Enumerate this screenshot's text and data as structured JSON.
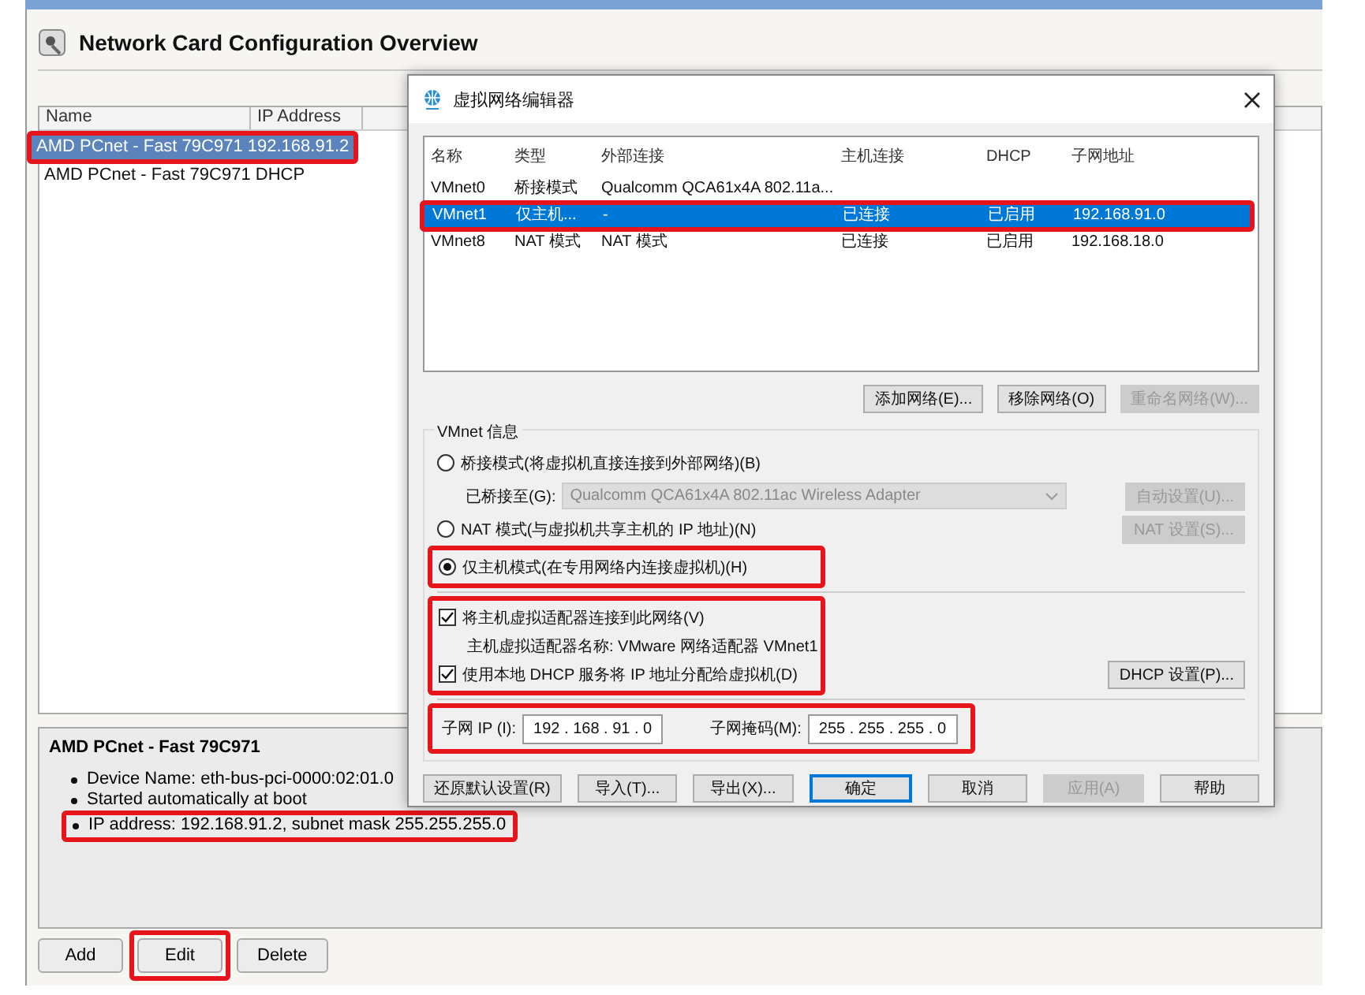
{
  "main_window": {
    "title": "Network Card Configuration Overview",
    "list": {
      "columns": [
        "Name",
        "IP Address"
      ],
      "rows": [
        {
          "name": "AMD PCnet - Fast 79C971",
          "ip": "192.168.91.2",
          "selected": true
        },
        {
          "name": "AMD PCnet - Fast 79C971",
          "ip": "DHCP",
          "selected": false
        }
      ]
    },
    "details": {
      "title": "AMD PCnet - Fast 79C971",
      "items": [
        "Device Name: eth-bus-pci-0000:02:01.0",
        "Started automatically at boot",
        "IP address: 192.168.91.2, subnet mask 255.255.255.0"
      ]
    },
    "buttons": [
      {
        "label": "Add"
      },
      {
        "label": "Edit"
      },
      {
        "label": "Delete"
      }
    ]
  },
  "dialog": {
    "title": "虚拟网络编辑器",
    "table": {
      "columns": [
        "名称",
        "类型",
        "外部连接",
        "主机连接",
        "DHCP",
        "子网地址"
      ],
      "rows": [
        {
          "cells": [
            "VMnet0",
            "桥接模式",
            "Qualcomm QCA61x4A 802.11a..."
          ],
          "selected": false
        },
        {
          "cells": [
            "VMnet1",
            "仅主机...",
            "-",
            "已连接",
            "已启用",
            "192.168.91.0"
          ],
          "selected": true
        },
        {
          "cells": [
            "VMnet8",
            "NAT 模式",
            "NAT 模式",
            "已连接",
            "已启用",
            "192.168.18.0"
          ],
          "selected": false
        }
      ]
    },
    "table_buttons": [
      {
        "label": "添加网络(E)...",
        "disabled": false
      },
      {
        "label": "移除网络(O)",
        "disabled": false
      },
      {
        "label": "重命名网络(W)...",
        "disabled": true
      }
    ],
    "group_title": "VMnet 信息",
    "modes": [
      {
        "label": "桥接模式(将虚拟机直接连接到外部网络)(B)",
        "selected": false
      },
      {
        "label": "NAT 模式(与虚拟机共享主机的 IP 地址)(N)",
        "selected": false
      },
      {
        "label": "仅主机模式(在专用网络内连接虚拟机)(H)",
        "selected": true
      }
    ],
    "bridged_to": {
      "label": "已桥接至(G):",
      "value": "Qualcomm QCA61x4A 802.11ac Wireless Adapter",
      "disabled": true
    },
    "auto_button": {
      "label": "自动设置(U)...",
      "disabled": true
    },
    "nat_button": {
      "label": "NAT 设置(S)...",
      "disabled": true
    },
    "checks": [
      {
        "label": "将主机虚拟适配器连接到此网络(V)",
        "checked": true
      },
      {
        "label": "使用本地 DHCP 服务将 IP 地址分配给虚拟机(D)",
        "checked": true
      }
    ],
    "adapter_name": "主机虚拟适配器名称: VMware 网络适配器 VMnet1",
    "dhcp_button": {
      "label": "DHCP 设置(P)...",
      "disabled": false
    },
    "subnet_ip": {
      "label": "子网 IP (I):",
      "value": "192 . 168 . 91 . 0"
    },
    "subnet_mask": {
      "label": "子网掩码(M):",
      "value": "255 . 255 . 255 . 0"
    },
    "footer_buttons": [
      {
        "label": "还原默认设置(R)",
        "disabled": false,
        "default": false
      },
      {
        "label": "导入(T)...",
        "disabled": false,
        "default": false
      },
      {
        "label": "导出(X)...",
        "disabled": false,
        "default": false
      },
      {
        "label": "确定",
        "disabled": false,
        "default": true
      },
      {
        "label": "取消",
        "disabled": false,
        "default": false
      },
      {
        "label": "应用(A)",
        "disabled": true,
        "default": false
      },
      {
        "label": "帮助",
        "disabled": false,
        "default": false
      }
    ]
  }
}
